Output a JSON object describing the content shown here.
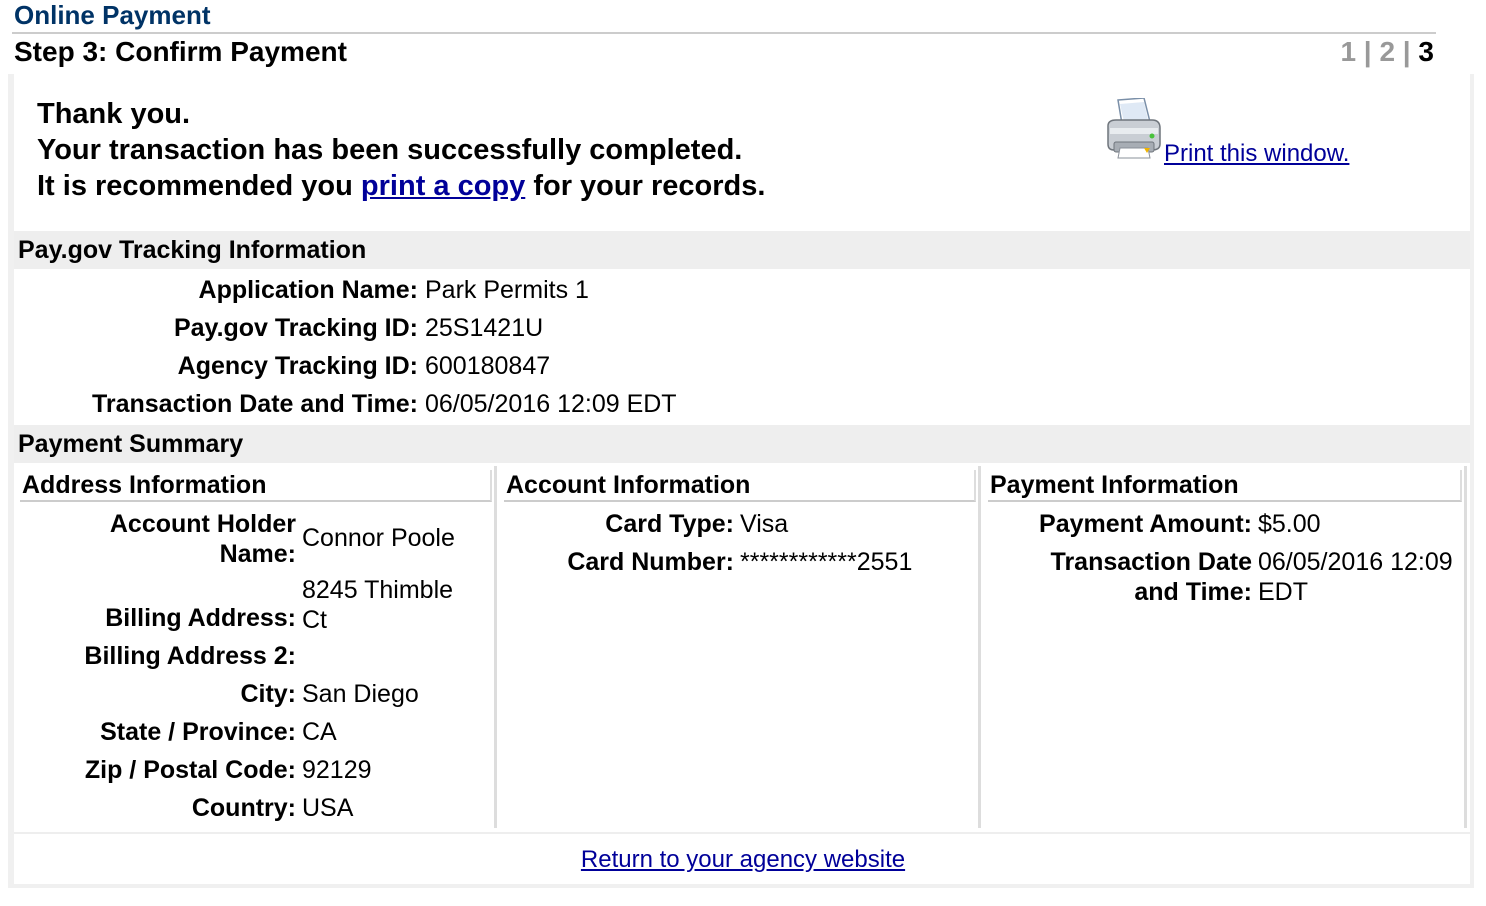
{
  "header": {
    "app_title": "Online Payment",
    "step_title": "Step 3: Confirm Payment",
    "steps": {
      "s1": "1",
      "sep1": " | ",
      "s2": "2",
      "sep2": " | ",
      "s3": "3"
    }
  },
  "confirmation": {
    "line1": "Thank you.",
    "line2": "Your transaction has been successfully completed.",
    "line3_prefix": "It is recommended you ",
    "line3_link": "print a copy",
    "line3_suffix": " for your records.",
    "print_window_link": " Print this window."
  },
  "tracking": {
    "title": "Pay.gov Tracking Information",
    "rows": [
      {
        "label": "Application Name:",
        "value": "Park Permits 1"
      },
      {
        "label": "Pay.gov Tracking ID:",
        "value": "25S1421U"
      },
      {
        "label": "Agency Tracking ID:",
        "value": "600180847"
      },
      {
        "label": "Transaction Date and Time:",
        "value": "06/05/2016 12:09 EDT"
      }
    ]
  },
  "summary": {
    "title": "Payment Summary",
    "address": {
      "title": "Address Information",
      "holder_label_1": "Account Holder",
      "holder_label_2": "Name:",
      "holder_value": "Connor Poole",
      "billing_label": "Billing Address:",
      "billing_value_1": "8245 Thimble",
      "billing_value_2": "Ct",
      "billing2_label": "Billing Address 2:",
      "billing2_value": "",
      "city_label": "City:",
      "city_value": "San Diego",
      "state_label": "State / Province:",
      "state_value": "CA",
      "zip_label": "Zip / Postal Code:",
      "zip_value": "92129",
      "country_label": "Country:",
      "country_value": "USA"
    },
    "account": {
      "title": "Account Information",
      "card_type_label": "Card Type:",
      "card_type_value": "Visa",
      "card_number_label": "Card Number:",
      "card_number_value": "************2551"
    },
    "payment": {
      "title": "Payment Information",
      "amount_label": "Payment Amount:",
      "amount_value": "$5.00",
      "date_label_1": "Transaction Date",
      "date_label_2": "and Time:",
      "date_value_1": "06/05/2016 12:09",
      "date_value_2": "EDT"
    }
  },
  "footer": {
    "return_link": "Return to your agency website"
  },
  "colors": {
    "title_blue": "#003366",
    "link_blue": "#000099",
    "section_bg": "#eeeeee",
    "step_inactive": "#999999"
  },
  "icons": {
    "print": "printer-icon"
  }
}
